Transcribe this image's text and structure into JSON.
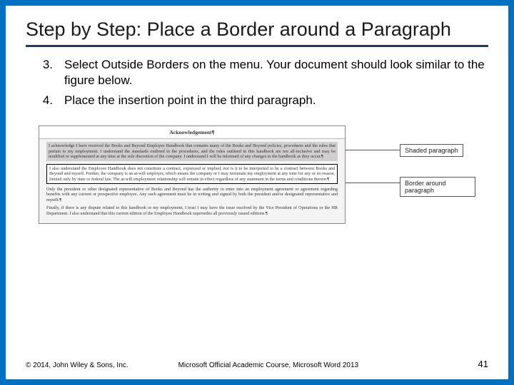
{
  "title": "Step by Step: Place a Border around a Paragraph",
  "steps": [
    {
      "num": "3.",
      "text": "Select Outside Borders on the menu. Your document should look similar to the figure below."
    },
    {
      "num": "4.",
      "text": "Place the insertion point in the third paragraph."
    }
  ],
  "figure": {
    "doc_title": "Acknowledgement¶",
    "para1": "I acknowledge I have received the Books and Beyond Employee Handbook that contains many of the Books and Beyond policies, procedures and the rules that pertain to my employment. I understand the standards outlined in the procedures, and the rules outlined in this handbook are not all-inclusive and may be modified or supplemented at any time at the sole discretion of the company. I understand I will be informed of any changes to the handbook as they occur.¶",
    "para2": "I also understand the Employee Handbook does not constitute a contract, expressed or implied, nor is it to be interpreted to be a contract between Books and Beyond and myself. Further, the company is an at-will employer, which means the company or I may terminate my employment at any time for any or no reason, limited only by state or federal law. The at-will employment relationship will remain in effect regardless of any statement in the terms and conditions therein.¶",
    "para3": "Only the president or other designated representative of Books and Beyond has the authority to enter into an employment agreement or agreement regarding benefits with any current or prospective employee. Any such agreement must be in writing and signed by both the president and/or designated representative and myself.¶",
    "para4": "Finally, if there is any dispute related to this handbook or my employment, I trust I may have the issue resolved by the Vice President of Operations or the HR Department. I also understand that this current edition of the Employee Handbook supersedes all previously issued editions.¶",
    "callout1": "Shaded paragraph",
    "callout2": "Border around paragraph"
  },
  "footer": {
    "copyright": "© 2014, John Wiley & Sons, Inc.",
    "course": "Microsoft Official Academic Course, Microsoft Word 2013",
    "page": "41"
  }
}
